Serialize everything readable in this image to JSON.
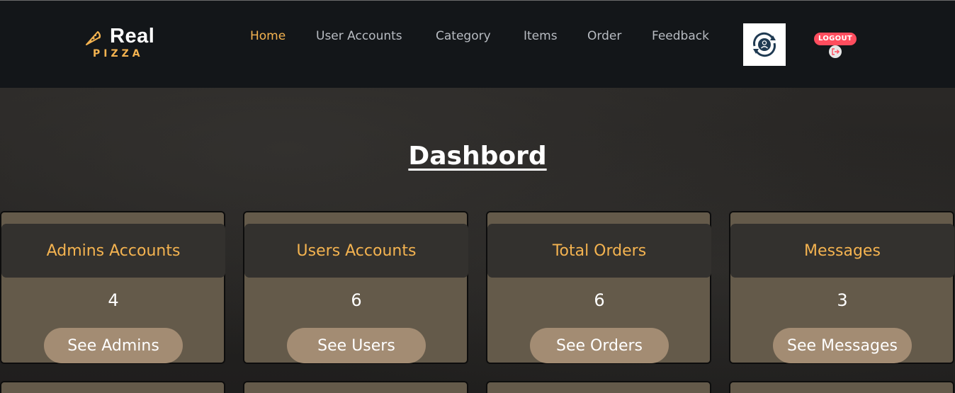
{
  "brand": {
    "name_top": "Real",
    "name_bottom": "PIZZA",
    "accent": "#f4b350"
  },
  "nav": {
    "links": [
      "Home",
      "User Accounts",
      "Category",
      "Items",
      "Order",
      "Feedback"
    ],
    "active": "Home",
    "profile_icon": "user-sync-icon",
    "logout_label": "LOGOUT",
    "logout_icon": "logout-icon"
  },
  "main": {
    "title": "Dashbord",
    "cards": [
      {
        "title": "Admins Accounts",
        "count": "4",
        "button": "See Admins"
      },
      {
        "title": "Users Accounts",
        "count": "6",
        "button": "See Users"
      },
      {
        "title": "Total Orders",
        "count": "6",
        "button": "See Orders"
      },
      {
        "title": "Messages",
        "count": "3",
        "button": "See Messages"
      }
    ]
  },
  "colors": {
    "navbar_bg": "#131619",
    "card_bg": "#645a4a",
    "card_head_bg": "#33312e",
    "button_bg": "#a38c73",
    "logout_bg": "#ff4d5e"
  }
}
